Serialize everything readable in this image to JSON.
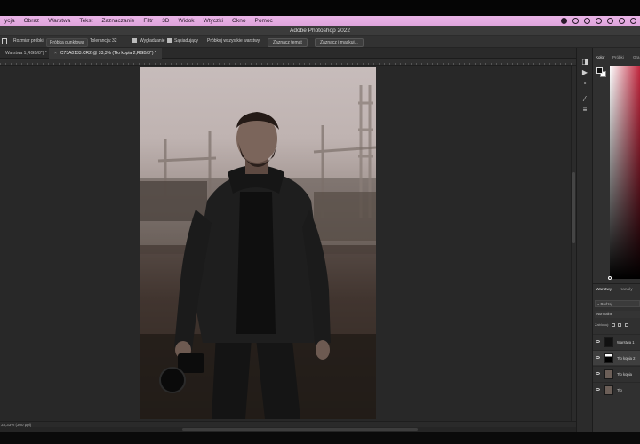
{
  "menubar": {
    "items": [
      "ycja",
      "Obraz",
      "Warstwa",
      "Tekst",
      "Zaznaczanie",
      "Filtr",
      "3D",
      "Widok",
      "Wtyczki",
      "Okno",
      "Pomoc"
    ]
  },
  "titlebar": {
    "title": "Adobe Photoshop 2022"
  },
  "options": {
    "sample_label": "Rozmiar próbki:",
    "sample_value": "Próbka punktowa",
    "tolerance_label": "Tolerancja:",
    "tolerance_value": "32",
    "antialias_label": "Wygładzanie",
    "contiguous_label": "Sąsiadujący",
    "sample_all_label": "Próbkuj wszystkie warstwy",
    "select_subject_label": "Zaznacz temat",
    "select_and_mask_label": "Zaznacz i maskuj..."
  },
  "tabs": [
    {
      "label": "Warstwa 1,RGB/8*) *"
    },
    {
      "label": "C73A0133.CR2 @ 33,3% (Tło kopia 2,RGB/8*) *"
    }
  ],
  "status": {
    "text": "33,33%   (300 ppi)"
  },
  "panels": {
    "color_tabs": [
      "Kolor",
      "Próbki",
      "Gra"
    ],
    "layer_tabs": [
      "Warstwy",
      "Kanały"
    ],
    "filter_label": "Rodzaj",
    "blend_mode": "Normalne",
    "lock_label": "Zablokuj:",
    "layers": [
      {
        "name": "Warstwa 1"
      },
      {
        "name": "Tło kopia 2"
      },
      {
        "name": "Tło kopia"
      },
      {
        "name": "Tło"
      }
    ]
  },
  "colors": {
    "accent_picker": "#c2283f",
    "menubar": "#e3aadf"
  }
}
